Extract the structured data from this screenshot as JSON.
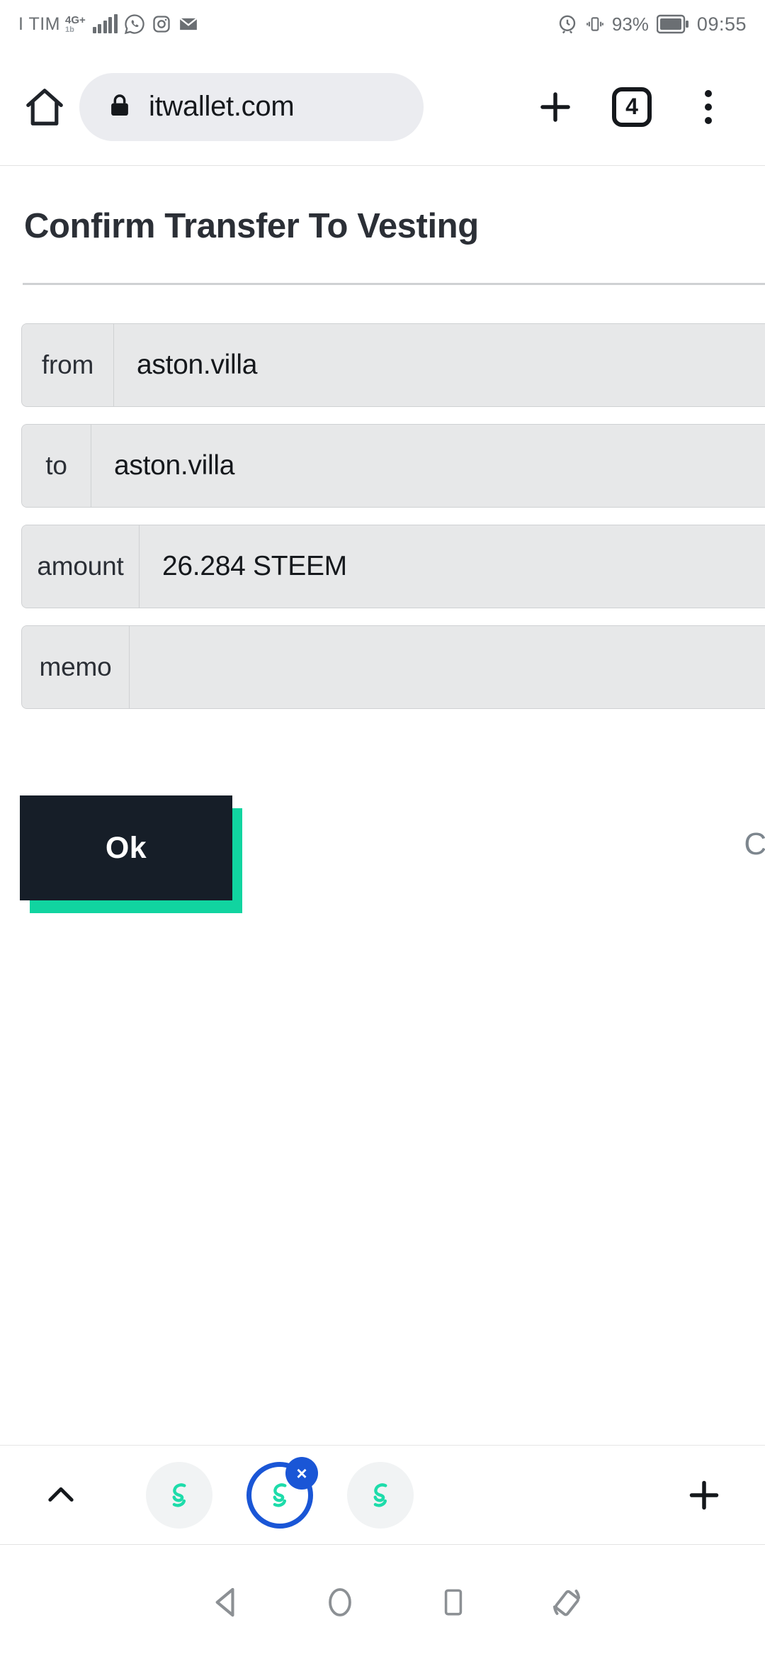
{
  "statusbar": {
    "carrier": "I TIM",
    "network_type": "4G+",
    "network_sub": "1b",
    "icons": [
      "signal-bars-icon",
      "whatsapp-icon",
      "instagram-icon",
      "gmail-icon"
    ],
    "right_icons": [
      "alarm-icon",
      "vibrate-icon",
      "battery-icon"
    ],
    "battery_percent": "93%",
    "clock": "09:55"
  },
  "browser": {
    "home_icon": "home-icon",
    "lock_icon": "lock-icon",
    "url": "itwallet.com",
    "new_tab_label": "+",
    "tab_count": "4",
    "menu_icon": "overflow-menu-icon"
  },
  "page": {
    "title": "Confirm Transfer To Vesting",
    "rows": [
      {
        "label": "from",
        "value": "aston.villa"
      },
      {
        "label": "to",
        "value": "aston.villa"
      },
      {
        "label": "amount",
        "value": "26.284 STEEM"
      },
      {
        "label": "memo",
        "value": ""
      }
    ],
    "ok_label": "Ok",
    "cancel_label": "Ca",
    "colors": {
      "ok_background": "#161e28",
      "ok_shadow": "#11d4a0",
      "ok_text": "#ffffff",
      "cancel_text": "#7d868e",
      "field_background": "#e7e8e9",
      "field_border": "#cfd1d3"
    }
  },
  "tabstrip": {
    "expand_icon": "chevron-up-icon",
    "tabs": [
      {
        "icon": "steem-favicon",
        "active": false
      },
      {
        "icon": "steem-favicon",
        "active": true,
        "close_label": "×"
      },
      {
        "icon": "steem-favicon",
        "active": false
      }
    ],
    "add_tab_icon": "plus-icon",
    "active_ring_color": "#1a56d6"
  },
  "navbar": {
    "buttons": [
      {
        "icon": "back-icon"
      },
      {
        "icon": "home-circle-icon"
      },
      {
        "icon": "recents-square-icon"
      },
      {
        "icon": "rotate-screen-icon"
      }
    ]
  }
}
